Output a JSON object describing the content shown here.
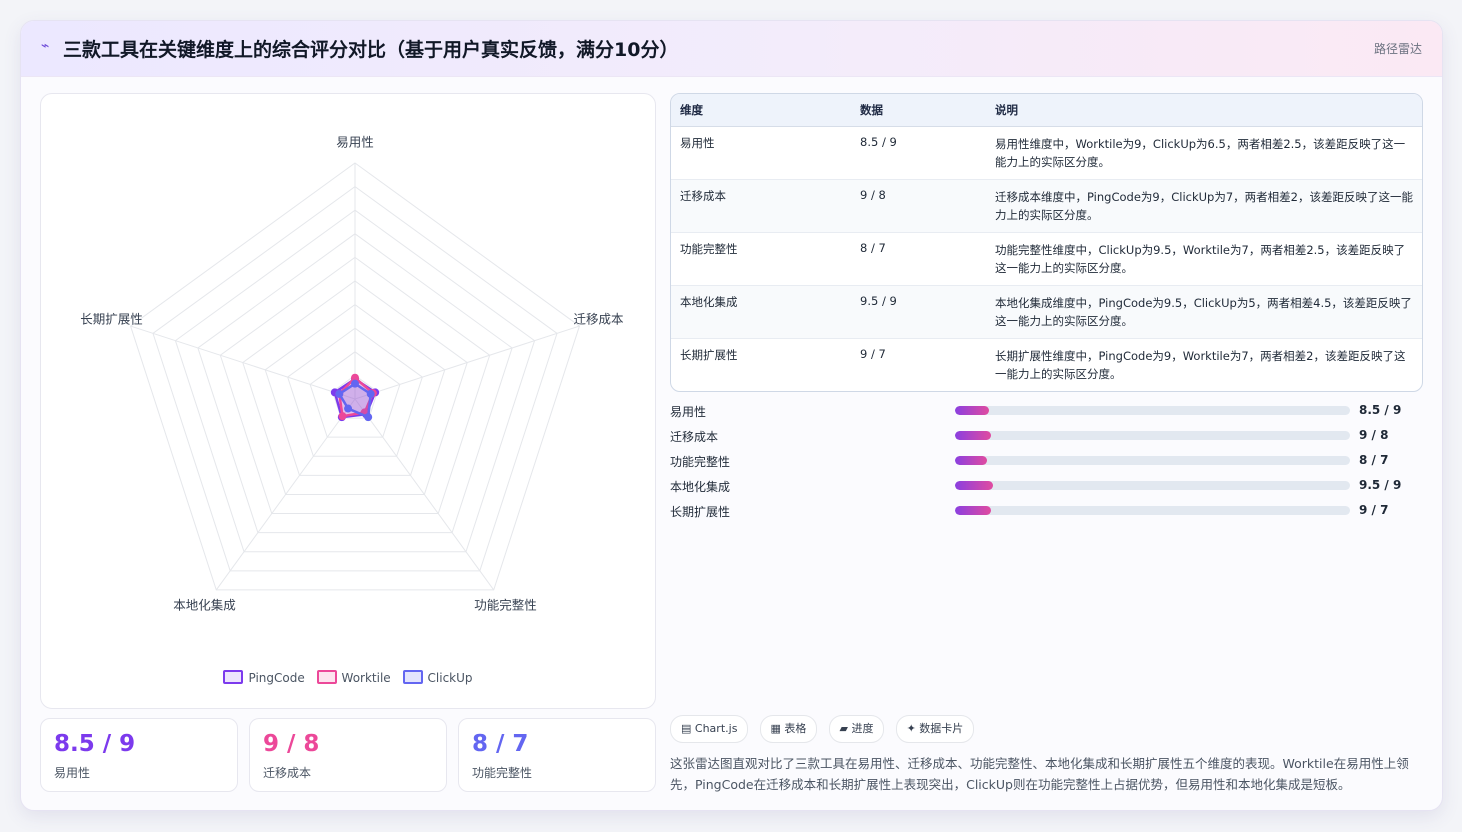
{
  "header": {
    "icon": "sparkle-icon",
    "title": "三款工具在关键维度上的综合评分对比（基于用户真实反馈，满分10分）",
    "tag": "路径雷达"
  },
  "chart_data": {
    "type": "radar",
    "title": "三款工具在关键维度上的综合评分对比（基于用户真实反馈，满分10分）",
    "axes": [
      "易用性",
      "迁移成本",
      "功能完整性",
      "本地化集成",
      "长期扩展性"
    ],
    "rlim": [
      0,
      100
    ],
    "grid": true,
    "legend": "bottom",
    "series": [
      {
        "name": "PingCode",
        "values": [
          8.5,
          9,
          8,
          9.5,
          9
        ],
        "color": "#7c3aed"
      },
      {
        "name": "Worktile",
        "values": [
          9,
          8,
          7,
          9,
          7
        ],
        "color": "#ec4899"
      },
      {
        "name": "ClickUp",
        "values": [
          6.5,
          7,
          9.5,
          5,
          7
        ],
        "color": "#6366f1"
      }
    ]
  },
  "legend": [
    {
      "name": "PingCode",
      "color": "#7c3aed"
    },
    {
      "name": "Worktile",
      "color": "#ec4899"
    },
    {
      "name": "ClickUp",
      "color": "#6366f1"
    }
  ],
  "stats": [
    {
      "value": "8.5 / 9",
      "label": "易用性",
      "color": "#7c3aed"
    },
    {
      "value": "9 / 8",
      "label": "迁移成本",
      "color": "#ec4899"
    },
    {
      "value": "8 / 7",
      "label": "功能完整性",
      "color": "#6366f1"
    }
  ],
  "table": {
    "headers": [
      "维度",
      "数据",
      "说明"
    ],
    "rows": [
      {
        "dim": "易用性",
        "data": "8.5 / 9",
        "desc": "易用性维度中，Worktile为9，ClickUp为6.5，两者相差2.5，该差距反映了这一能力上的实际区分度。"
      },
      {
        "dim": "迁移成本",
        "data": "9 / 8",
        "desc": "迁移成本维度中，PingCode为9，ClickUp为7，两者相差2，该差距反映了这一能力上的实际区分度。"
      },
      {
        "dim": "功能完整性",
        "data": "8 / 7",
        "desc": "功能完整性维度中，ClickUp为9.5，Worktile为7，两者相差2.5，该差距反映了这一能力上的实际区分度。"
      },
      {
        "dim": "本地化集成",
        "data": "9.5 / 9",
        "desc": "本地化集成维度中，PingCode为9.5，ClickUp为5，两者相差4.5，该差距反映了这一能力上的实际区分度。"
      },
      {
        "dim": "长期扩展性",
        "data": "9 / 7",
        "desc": "长期扩展性维度中，PingCode为9，Worktile为7，两者相差2，该差距反映了这一能力上的实际区分度。"
      }
    ]
  },
  "progress": [
    {
      "label": "易用性",
      "value": "8.5 / 9",
      "fraction": 0.085
    },
    {
      "label": "迁移成本",
      "value": "9 / 8",
      "fraction": 0.09
    },
    {
      "label": "功能完整性",
      "value": "8 / 7",
      "fraction": 0.08
    },
    {
      "label": "本地化集成",
      "value": "9.5 / 9",
      "fraction": 0.095
    },
    {
      "label": "长期扩展性",
      "value": "9 / 7",
      "fraction": 0.09
    }
  ],
  "chips": [
    {
      "icon": "chart-icon",
      "glyph": "▤",
      "label": "Chart.js"
    },
    {
      "icon": "table-icon",
      "glyph": "▦",
      "label": "表格"
    },
    {
      "icon": "progress-icon",
      "glyph": "▰",
      "label": "进度"
    },
    {
      "icon": "card-icon",
      "glyph": "✦",
      "label": "数据卡片"
    }
  ],
  "summary": "这张雷达图直观对比了三款工具在易用性、迁移成本、功能完整性、本地化集成和长期扩展性五个维度的表现。Worktile在易用性上领先，PingCode在迁移成本和长期扩展性上表现突出，ClickUp则在功能完整性上占据优势，但易用性和本地化集成是短板。"
}
